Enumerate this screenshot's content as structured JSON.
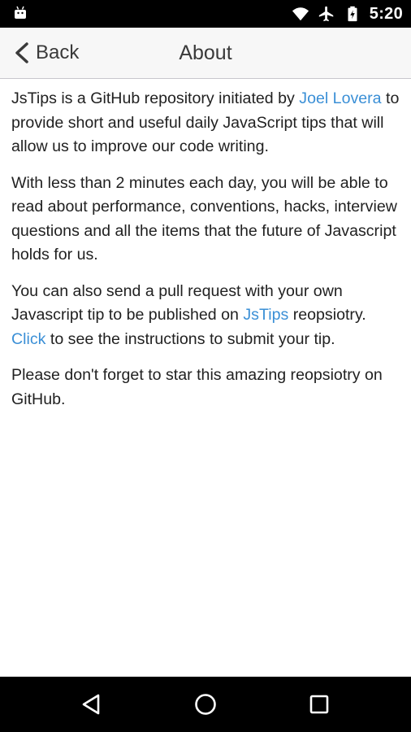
{
  "status_bar": {
    "time": "5:20",
    "icons": [
      "android-icon",
      "wifi-icon",
      "airplane-icon",
      "battery-charging-icon"
    ]
  },
  "nav": {
    "back_label": "Back",
    "title": "About",
    "icons": [
      "chevron-left-icon"
    ]
  },
  "content": {
    "p1": {
      "before": "JsTips is a GitHub repository initiated by ",
      "link": "Joel Lovera",
      "after": " to provide short and useful daily JavaScript tips that will allow us to improve our code writing."
    },
    "p2": "With less than 2 minutes each day, you will be able to read about performance, conventions, hacks, interview questions and all the items that the future of Javascript holds for us.",
    "p3": {
      "before": "You can also send a pull request with your own Javascript tip to be published on ",
      "link1": "JsTips",
      "middle": " reopsiotry. ",
      "link2": "Click",
      "after": " to see the instructions to submit your tip."
    },
    "p4": "Please don't forget to star this amazing reopsiotry on GitHub."
  },
  "bottom_nav": {
    "icons": [
      "back-triangle-icon",
      "home-circle-icon",
      "recents-square-icon"
    ]
  },
  "colors": {
    "link": "#3a8fd6",
    "navbar_bg": "#f7f7f7",
    "status_bg": "#000000",
    "text": "#212121"
  }
}
